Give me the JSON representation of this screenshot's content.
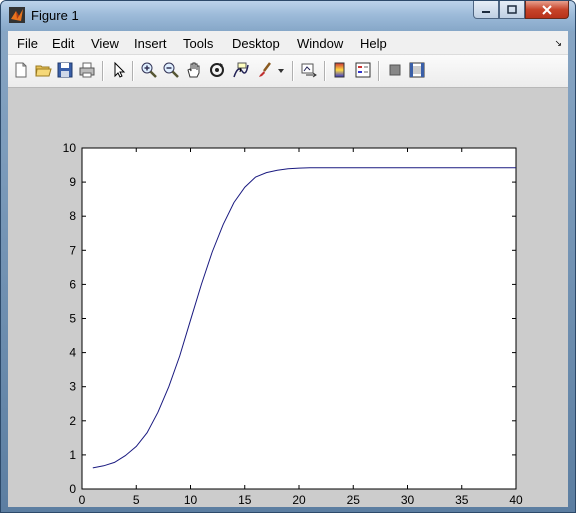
{
  "window": {
    "title": "Figure 1"
  },
  "menu": {
    "items": [
      {
        "label": "File"
      },
      {
        "label": "Edit"
      },
      {
        "label": "View"
      },
      {
        "label": "Insert"
      },
      {
        "label": "Tools"
      },
      {
        "label": "Desktop"
      },
      {
        "label": "Window"
      },
      {
        "label": "Help"
      }
    ]
  },
  "toolbar": {
    "icons": [
      "new-figure-icon",
      "open-file-icon",
      "save-icon",
      "print-icon",
      "edit-plot-icon",
      "zoom-in-icon",
      "zoom-out-icon",
      "pan-icon",
      "rotate-3d-icon",
      "data-cursor-icon",
      "brush-icon",
      "brush-dropdown-icon",
      "link-plot-icon",
      "colorbar-icon",
      "legend-icon",
      "hide-plot-tools-icon",
      "show-plot-tools-icon"
    ]
  },
  "colors": {
    "line": "#1a1a80",
    "figure_bg": "#cccccc",
    "axes_bg": "#ffffff"
  },
  "chart_data": {
    "type": "line",
    "title": "",
    "xlabel": "",
    "ylabel": "",
    "xlim": [
      0,
      40
    ],
    "ylim": [
      0,
      10
    ],
    "xticks": [
      0,
      5,
      10,
      15,
      20,
      25,
      30,
      35,
      40
    ],
    "yticks": [
      0,
      1,
      2,
      3,
      4,
      5,
      6,
      7,
      8,
      9,
      10
    ],
    "grid": false,
    "series": [
      {
        "x": [
          1,
          2,
          3,
          4,
          5,
          6,
          7,
          8,
          9,
          10,
          11,
          12,
          13,
          14,
          15,
          16,
          17,
          18,
          19,
          20,
          21,
          22,
          23,
          24,
          25,
          26,
          27,
          28,
          29,
          30,
          31,
          32,
          33,
          34,
          35,
          36,
          37,
          38,
          39,
          40
        ],
        "y": [
          0.62,
          0.68,
          0.78,
          0.98,
          1.25,
          1.65,
          2.25,
          3.0,
          3.9,
          4.95,
          6.0,
          6.95,
          7.75,
          8.4,
          8.85,
          9.15,
          9.28,
          9.35,
          9.39,
          9.41,
          9.42,
          9.42,
          9.42,
          9.42,
          9.42,
          9.42,
          9.42,
          9.42,
          9.42,
          9.42,
          9.42,
          9.42,
          9.42,
          9.42,
          9.42,
          9.42,
          9.42,
          9.42,
          9.42,
          9.42
        ]
      }
    ]
  }
}
